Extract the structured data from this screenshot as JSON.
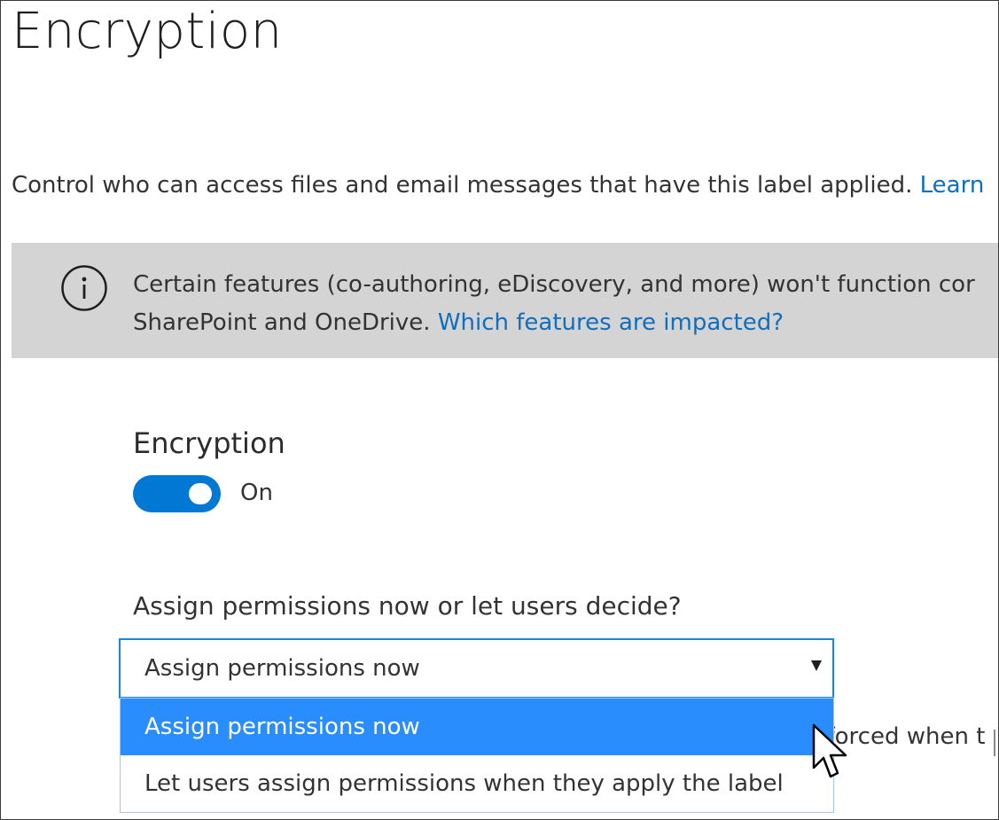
{
  "page": {
    "title": "Encryption",
    "description": "Control who can access files and email messages that have this label applied.",
    "learn_more_link": "Learn"
  },
  "info_banner": {
    "icon": "info-icon",
    "line1": "Certain features (co-authoring, eDiscovery, and more) won't function cor",
    "line2_text": "SharePoint and OneDrive.",
    "line2_link": "Which features are impacted?"
  },
  "encryption_section": {
    "title": "Encryption",
    "toggle_state": "On",
    "toggle_on": true
  },
  "permissions": {
    "label": "Assign permissions now or let users decide?",
    "selected_value": "Assign permissions now",
    "options": [
      {
        "label": "Assign permissions now",
        "highlighted": true
      },
      {
        "label": "Let users assign permissions when they apply the label",
        "highlighted": false
      }
    ]
  },
  "obscured_text": "nforced when t",
  "colors": {
    "accent": "#0078d4",
    "link": "#106ebe",
    "highlight": "#2a8dfd",
    "banner_bg": "#d4d4d4"
  }
}
